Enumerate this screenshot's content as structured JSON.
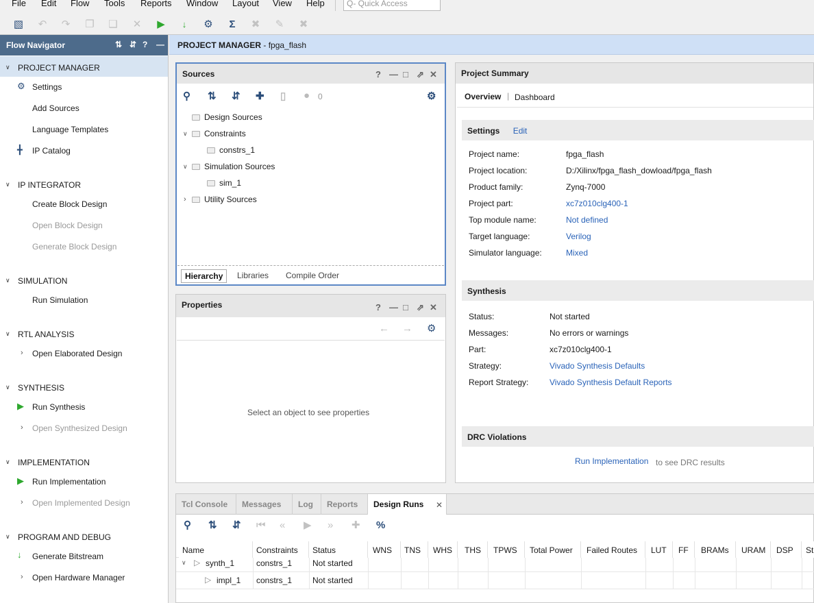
{
  "menu": [
    "File",
    "Edit",
    "Flow",
    "Tools",
    "Reports",
    "Window",
    "Layout",
    "View",
    "Help"
  ],
  "quick_access": {
    "placeholder": "Q- Quick Access"
  },
  "flow_navigator": {
    "title": "Flow Navigator",
    "sections": [
      {
        "label": "PROJECT MANAGER",
        "items": [
          "Settings",
          "Add Sources",
          "Language Templates",
          "IP Catalog"
        ]
      },
      {
        "label": "IP INTEGRATOR",
        "items": [
          "Create Block Design",
          "Open Block Design",
          "Generate Block Design"
        ]
      },
      {
        "label": "SIMULATION",
        "items": [
          "Run Simulation"
        ]
      },
      {
        "label": "RTL ANALYSIS",
        "items": [
          "Open Elaborated Design"
        ]
      },
      {
        "label": "SYNTHESIS",
        "items": [
          "Run Synthesis",
          "Open Synthesized Design"
        ]
      },
      {
        "label": "IMPLEMENTATION",
        "items": [
          "Run Implementation",
          "Open Implemented Design"
        ]
      },
      {
        "label": "PROGRAM AND DEBUG",
        "items": [
          "Generate Bitstream",
          "Open Hardware Manager"
        ]
      }
    ]
  },
  "main_header": {
    "prefix": "PROJECT MANAGER",
    "name": "fpga_flash"
  },
  "sources": {
    "title": "Sources",
    "count": "0",
    "tree": [
      "Design Sources",
      "Constraints",
      "constrs_1",
      "Simulation Sources",
      "sim_1",
      "Utility Sources"
    ],
    "tabs": [
      "Hierarchy",
      "Libraries",
      "Compile Order"
    ]
  },
  "properties": {
    "title": "Properties",
    "empty_text": "Select an object to see properties"
  },
  "summary": {
    "title": "Project Summary",
    "tabs": [
      "Overview",
      "Dashboard"
    ],
    "settings": {
      "title": "Settings",
      "edit": "Edit",
      "rows": [
        {
          "label": "Project name:",
          "value": "fpga_flash"
        },
        {
          "label": "Project location:",
          "value": "D:/Xilinx/fpga_flash_dowload/fpga_flash"
        },
        {
          "label": "Product family:",
          "value": "Zynq-7000"
        },
        {
          "label": "Project part:",
          "value": "xc7z010clg400-1"
        },
        {
          "label": "Top module name:",
          "value": "Not defined"
        },
        {
          "label": "Target language:",
          "value": "Verilog"
        },
        {
          "label": "Simulator language:",
          "value": "Mixed"
        }
      ]
    },
    "synthesis": {
      "title": "Synthesis",
      "rows": [
        {
          "label": "Status:",
          "value": "Not started"
        },
        {
          "label": "Messages:",
          "value": "No errors or warnings"
        },
        {
          "label": "Part:",
          "value": "xc7z010clg400-1"
        },
        {
          "label": "Strategy:",
          "value": "Vivado Synthesis Defaults"
        },
        {
          "label": "Report Strategy:",
          "value": "Vivado Synthesis Default Reports"
        }
      ]
    },
    "drc": {
      "title": "DRC Violations",
      "link": "Run Implementation",
      "suffix": "to see DRC results"
    }
  },
  "bottom": {
    "tabs": [
      "Tcl Console",
      "Messages",
      "Log",
      "Reports",
      "Design Runs"
    ],
    "columns": [
      "Name",
      "Constraints",
      "Status",
      "WNS",
      "TNS",
      "WHS",
      "THS",
      "TPWS",
      "Total Power",
      "Failed Routes",
      "LUT",
      "FF",
      "BRAMs",
      "URAM",
      "DSP",
      "St"
    ],
    "rows": [
      {
        "name": "synth_1",
        "constraints": "constrs_1",
        "status": "Not started"
      },
      {
        "name": "impl_1",
        "constraints": "constrs_1",
        "status": "Not started"
      }
    ]
  },
  "colors": {
    "accent": "#4d6b8b",
    "link": "#2a63b8",
    "header": "#cfe0f6",
    "run_green": "#2ea82e"
  }
}
